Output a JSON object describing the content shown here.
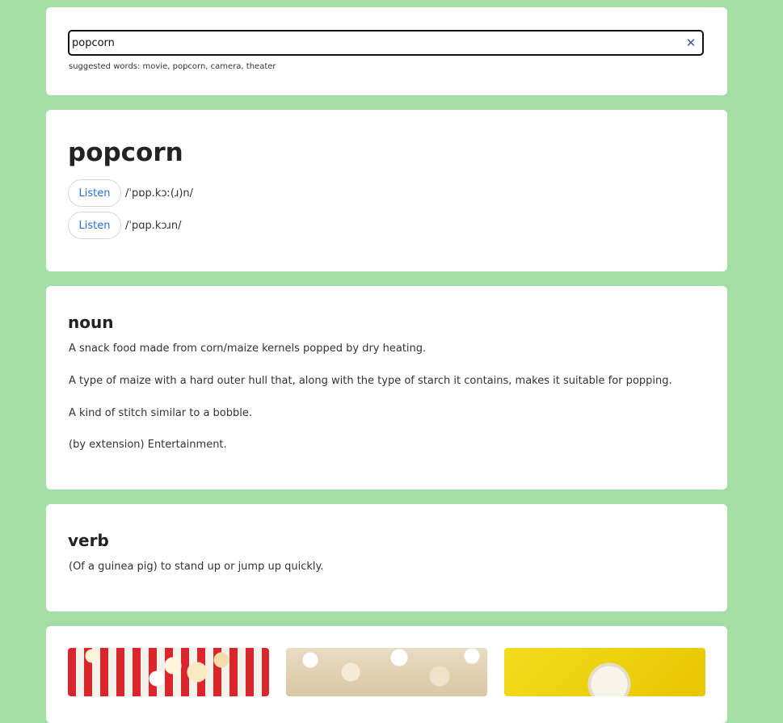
{
  "search": {
    "value": "popcorn",
    "clear_icon": "close-icon",
    "suggested": "suggested words: movie, popcorn, camera, theater"
  },
  "word": {
    "title": "popcorn",
    "phonetics": [
      {
        "listen_label": "Listen",
        "text": "/ˈpɒp.kɔː(ɹ)n/"
      },
      {
        "listen_label": "Listen",
        "text": "/ˈpɑp.kɔɹn/"
      }
    ]
  },
  "meanings": [
    {
      "part_of_speech": "noun",
      "definitions": [
        "A snack food made from corn/maize kernels popped by dry heating.",
        "A type of maize with a hard outer hull that, along with the type of starch it contains, makes it suitable for popping.",
        "A kind of stitch similar to a bobble.",
        "(by extension) Entertainment."
      ]
    },
    {
      "part_of_speech": "verb",
      "definitions": [
        "(Of a guinea pig) to stand up or jump up quickly."
      ]
    }
  ],
  "images": [
    "popcorn-box-photo",
    "popcorn-closeup-photo",
    "popcorn-bowl-yellow-photo"
  ],
  "colors": {
    "background": "#a3dea5",
    "card": "#ffffff",
    "accent": "#2a6fdb"
  }
}
